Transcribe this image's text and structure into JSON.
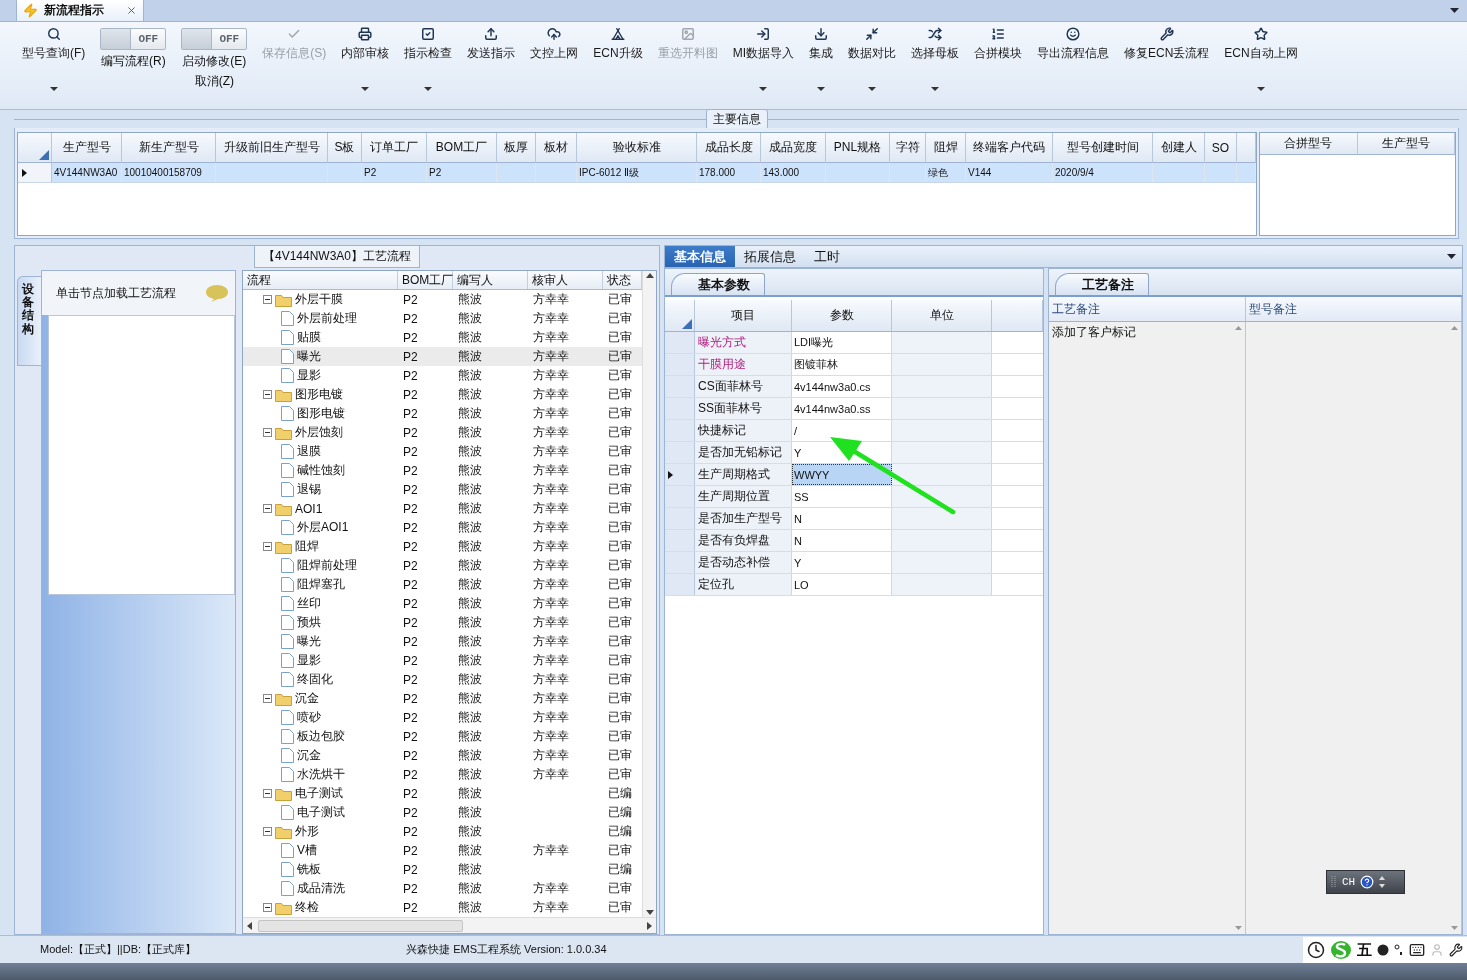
{
  "document_tab": {
    "title": "新流程指示"
  },
  "toolbar": {
    "items": [
      {
        "kind": "button",
        "label": "型号查询(F)",
        "dropdown": true,
        "disabled": false
      },
      {
        "kind": "toggle",
        "label": "编写流程(R)",
        "state_text": "OFF",
        "on": false
      },
      {
        "kind": "toggle",
        "label": "启动修改(E)",
        "sublabel": "取消(Z)",
        "state_text": "OFF",
        "on": false
      },
      {
        "kind": "button",
        "label": "保存信息(S)",
        "dropdown": false,
        "disabled": true
      },
      {
        "kind": "button",
        "label": "内部审核",
        "dropdown": true,
        "disabled": false
      },
      {
        "kind": "button",
        "label": "指示检查",
        "dropdown": true,
        "disabled": false
      },
      {
        "kind": "button",
        "label": "发送指示",
        "dropdown": false,
        "disabled": false
      },
      {
        "kind": "button",
        "label": "文控上网",
        "dropdown": false,
        "disabled": false
      },
      {
        "kind": "button",
        "label": "ECN升级",
        "dropdown": false,
        "disabled": false
      },
      {
        "kind": "button",
        "label": "重选开料图",
        "dropdown": false,
        "disabled": true
      },
      {
        "kind": "button",
        "label": "MI数据导入",
        "dropdown": true,
        "disabled": false
      },
      {
        "kind": "button",
        "label": "集成",
        "dropdown": true,
        "disabled": false
      },
      {
        "kind": "button",
        "label": "数据对比",
        "dropdown": true,
        "disabled": false
      },
      {
        "kind": "button",
        "label": "选择母板",
        "dropdown": true,
        "disabled": false
      },
      {
        "kind": "button",
        "label": "合拼模块",
        "dropdown": false,
        "disabled": false
      },
      {
        "kind": "button",
        "label": "导出流程信息",
        "dropdown": false,
        "disabled": false
      },
      {
        "kind": "button",
        "label": "修复ECN丢流程",
        "dropdown": false,
        "disabled": false
      },
      {
        "kind": "button",
        "label": "ECN自动上网",
        "dropdown": true,
        "disabled": false
      }
    ]
  },
  "main_info": {
    "title": "主要信息",
    "columns": [
      {
        "label": "生产型号",
        "values": [
          "4V144NW3A0"
        ]
      },
      {
        "label": "新生产型号",
        "values": [
          "10010400158709"
        ]
      },
      {
        "label": "升级前旧生产型号"
      },
      {
        "label": "S板"
      },
      {
        "label": "订单工厂",
        "values": [
          "P2"
        ]
      },
      {
        "label": "BOM工厂",
        "values": [
          "P2"
        ]
      },
      {
        "label": "板厚"
      },
      {
        "label": "板材"
      },
      {
        "label": "验收标准",
        "values": [
          "IPC-6012 Ⅱ级"
        ]
      },
      {
        "label": "成品长度",
        "values": [
          "178.000"
        ]
      },
      {
        "label": "成品宽度",
        "values": [
          "143.000"
        ]
      },
      {
        "label": "PNL规格"
      },
      {
        "label": "字符"
      },
      {
        "label": "阻焊",
        "values": [
          "绿色"
        ]
      },
      {
        "label": "终端客户代码",
        "values": [
          "V144"
        ]
      },
      {
        "label": "型号创建时间",
        "values": [
          "2020/9/4"
        ]
      },
      {
        "label": "创建人"
      },
      {
        "label": "SO"
      }
    ],
    "rows": [
      {
        "selected": true
      }
    ],
    "side_columns": [
      "合拼型号",
      "生产型号"
    ]
  },
  "flow_panel": {
    "title": "【4V144NW3A0】工艺流程",
    "side_tab": "设备结构",
    "hint": "单击节点加载工艺流程",
    "columns": [
      "流程",
      "BOM工厂",
      "编写人",
      "核审人",
      "状态"
    ],
    "rows": [
      {
        "name": "外层干膜",
        "bom": "P2",
        "writer": "熊波",
        "reviewer": "方幸幸",
        "status": "已审",
        "selected": false,
        "expanded": true,
        "children": [
          {
            "name": "外层前处理",
            "bom": "P2",
            "writer": "熊波",
            "reviewer": "方幸幸",
            "status": "已审",
            "selected": false
          },
          {
            "name": "贴膜",
            "bom": "P2",
            "writer": "熊波",
            "reviewer": "方幸幸",
            "status": "已审",
            "selected": false
          },
          {
            "name": "曝光",
            "bom": "P2",
            "writer": "熊波",
            "reviewer": "方幸幸",
            "status": "已审",
            "selected": true
          },
          {
            "name": "显影",
            "bom": "P2",
            "writer": "熊波",
            "reviewer": "方幸幸",
            "status": "已审",
            "selected": false
          }
        ]
      },
      {
        "name": "图形电镀",
        "bom": "P2",
        "writer": "熊波",
        "reviewer": "方幸幸",
        "status": "已审",
        "selected": false,
        "expanded": true,
        "children": [
          {
            "name": "图形电镀",
            "bom": "P2",
            "writer": "熊波",
            "reviewer": "方幸幸",
            "status": "已审",
            "selected": false
          }
        ]
      },
      {
        "name": "外层蚀刻",
        "bom": "P2",
        "writer": "熊波",
        "reviewer": "方幸幸",
        "status": "已审",
        "selected": false,
        "expanded": true,
        "children": [
          {
            "name": "退膜",
            "bom": "P2",
            "writer": "熊波",
            "reviewer": "方幸幸",
            "status": "已审",
            "selected": false
          },
          {
            "name": "碱性蚀刻",
            "bom": "P2",
            "writer": "熊波",
            "reviewer": "方幸幸",
            "status": "已审",
            "selected": false
          },
          {
            "name": "退锡",
            "bom": "P2",
            "writer": "熊波",
            "reviewer": "方幸幸",
            "status": "已审",
            "selected": false
          }
        ]
      },
      {
        "name": "AOI1",
        "bom": "P2",
        "writer": "熊波",
        "reviewer": "方幸幸",
        "status": "已审",
        "selected": false,
        "expanded": true,
        "children": [
          {
            "name": "外层AOI1",
            "bom": "P2",
            "writer": "熊波",
            "reviewer": "方幸幸",
            "status": "已审",
            "selected": false
          }
        ]
      },
      {
        "name": "阻焊",
        "bom": "P2",
        "writer": "熊波",
        "reviewer": "方幸幸",
        "status": "已审",
        "selected": false,
        "expanded": true,
        "children": [
          {
            "name": "阻焊前处理",
            "bom": "P2",
            "writer": "熊波",
            "reviewer": "方幸幸",
            "status": "已审",
            "selected": false
          },
          {
            "name": "阻焊塞孔",
            "bom": "P2",
            "writer": "熊波",
            "reviewer": "方幸幸",
            "status": "已审",
            "selected": false
          },
          {
            "name": "丝印",
            "bom": "P2",
            "writer": "熊波",
            "reviewer": "方幸幸",
            "status": "已审",
            "selected": false
          },
          {
            "name": "预烘",
            "bom": "P2",
            "writer": "熊波",
            "reviewer": "方幸幸",
            "status": "已审",
            "selected": false
          },
          {
            "name": "曝光",
            "bom": "P2",
            "writer": "熊波",
            "reviewer": "方幸幸",
            "status": "已审",
            "selected": false
          },
          {
            "name": "显影",
            "bom": "P2",
            "writer": "熊波",
            "reviewer": "方幸幸",
            "status": "已审",
            "selected": false
          },
          {
            "name": "终固化",
            "bom": "P2",
            "writer": "熊波",
            "reviewer": "方幸幸",
            "status": "已审",
            "selected": false
          }
        ]
      },
      {
        "name": "沉金",
        "bom": "P2",
        "writer": "熊波",
        "reviewer": "方幸幸",
        "status": "已审",
        "selected": false,
        "expanded": true,
        "children": [
          {
            "name": "喷砂",
            "bom": "P2",
            "writer": "熊波",
            "reviewer": "方幸幸",
            "status": "已审",
            "selected": false
          },
          {
            "name": "板边包胶",
            "bom": "P2",
            "writer": "熊波",
            "reviewer": "方幸幸",
            "status": "已审",
            "selected": false
          },
          {
            "name": "沉金",
            "bom": "P2",
            "writer": "熊波",
            "reviewer": "方幸幸",
            "status": "已审",
            "selected": false
          },
          {
            "name": "水洗烘干",
            "bom": "P2",
            "writer": "熊波",
            "reviewer": "方幸幸",
            "status": "已审",
            "selected": false
          }
        ]
      },
      {
        "name": "电子测试",
        "bom": "P2",
        "writer": "熊波",
        "status": "已编",
        "selected": false,
        "expanded": true,
        "children": [
          {
            "name": "电子测试",
            "bom": "P2",
            "writer": "熊波",
            "status": "已编",
            "selected": false
          }
        ]
      },
      {
        "name": "外形",
        "bom": "P2",
        "writer": "熊波",
        "status": "已编",
        "selected": false,
        "expanded": true,
        "children": [
          {
            "name": "V槽",
            "bom": "P2",
            "writer": "熊波",
            "reviewer": "方幸幸",
            "status": "已审",
            "selected": false
          },
          {
            "name": "铣板",
            "bom": "P2",
            "writer": "熊波",
            "status": "已编",
            "selected": false
          },
          {
            "name": "成品清洗",
            "bom": "P2",
            "writer": "熊波",
            "reviewer": "方幸幸",
            "status": "已审",
            "selected": false
          }
        ]
      },
      {
        "name": "终检",
        "bom": "P2",
        "writer": "熊波",
        "reviewer": "方幸幸",
        "status": "已审",
        "selected": false,
        "expanded": true
      }
    ]
  },
  "detail_tabs": [
    {
      "label": "基本信息",
      "selected": true
    },
    {
      "label": "拓展信息",
      "selected": false
    },
    {
      "label": "工时",
      "selected": false
    }
  ],
  "params": {
    "tab": "基本参数",
    "columns": [
      "项目",
      "参数",
      "单位"
    ],
    "rows": [
      {
        "item": "曝光方式",
        "value": "LDI曝光",
        "required": true,
        "selected": false
      },
      {
        "item": "干膜用途",
        "value": "图镀菲林",
        "required": true,
        "selected": false
      },
      {
        "item": "CS面菲林号",
        "value": "4v144nw3a0.cs",
        "required": false,
        "selected": false
      },
      {
        "item": "SS面菲林号",
        "value": "4v144nw3a0.ss",
        "required": false,
        "selected": false
      },
      {
        "item": "快捷标记",
        "value": "/",
        "required": false,
        "selected": false
      },
      {
        "item": "是否加无铅标记",
        "value": "Y",
        "required": false,
        "selected": false
      },
      {
        "item": "生产周期格式",
        "value": "WWYY",
        "required": false,
        "selected": true
      },
      {
        "item": "生产周期位置",
        "value": "SS",
        "required": false,
        "selected": false
      },
      {
        "item": "是否加生产型号",
        "value": "N",
        "required": false,
        "selected": false
      },
      {
        "item": "是否有负焊盘",
        "value": "N",
        "required": false,
        "selected": false
      },
      {
        "item": "是否动态补偿",
        "value": "Y",
        "required": false,
        "selected": false
      },
      {
        "item": "定位孔",
        "value": "LO",
        "required": false,
        "selected": false
      }
    ]
  },
  "notes": {
    "tab": "工艺备注",
    "columns": [
      "工艺备注",
      "型号备注"
    ],
    "process_note": "添加了客户标记"
  },
  "ime_bar": {
    "language": "CH"
  },
  "status_bar": {
    "left": "Model:【正式】||DB:【正式库】",
    "center": "兴森快捷 EMS工程系统 Version: 1.0.0.34",
    "ime_mode": "五"
  }
}
